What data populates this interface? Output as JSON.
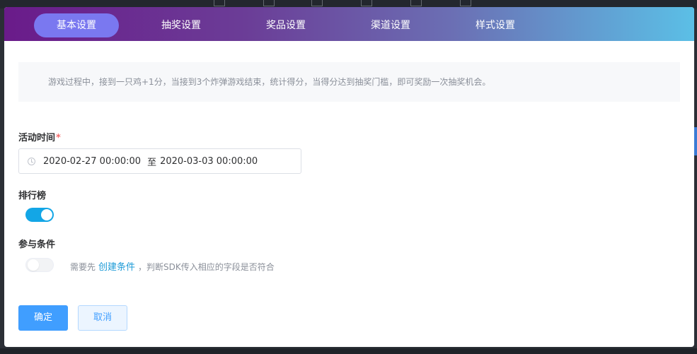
{
  "tabs": [
    {
      "label": "基本设置",
      "active": true
    },
    {
      "label": "抽奖设置",
      "active": false
    },
    {
      "label": "奖品设置",
      "active": false
    },
    {
      "label": "渠道设置",
      "active": false
    },
    {
      "label": "样式设置",
      "active": false
    }
  ],
  "notice": "游戏过程中，接到一只鸡+1分，当接到3个炸弹游戏结束，统计得分，当得分达到抽奖门槛，即可奖励一次抽奖机会。",
  "activity_time": {
    "label": "活动时间",
    "required_mark": "*",
    "start": "2020-02-27 00:00:00",
    "separator": "至",
    "end": "2020-03-03 00:00:00",
    "icon": "clock-icon"
  },
  "leaderboard": {
    "label": "排行榜",
    "enabled": true
  },
  "participation": {
    "label": "参与条件",
    "enabled": false,
    "hint_prefix": "需要先",
    "link": "创建条件",
    "hint_suffix": "，判断SDK传入相应的字段是否符合"
  },
  "actions": {
    "confirm": "确定",
    "cancel": "取消"
  },
  "colors": {
    "accent": "#409eff",
    "switch_on": "#13a6e6",
    "required": "#f56c6c",
    "active_tab": "#7a78f0"
  }
}
